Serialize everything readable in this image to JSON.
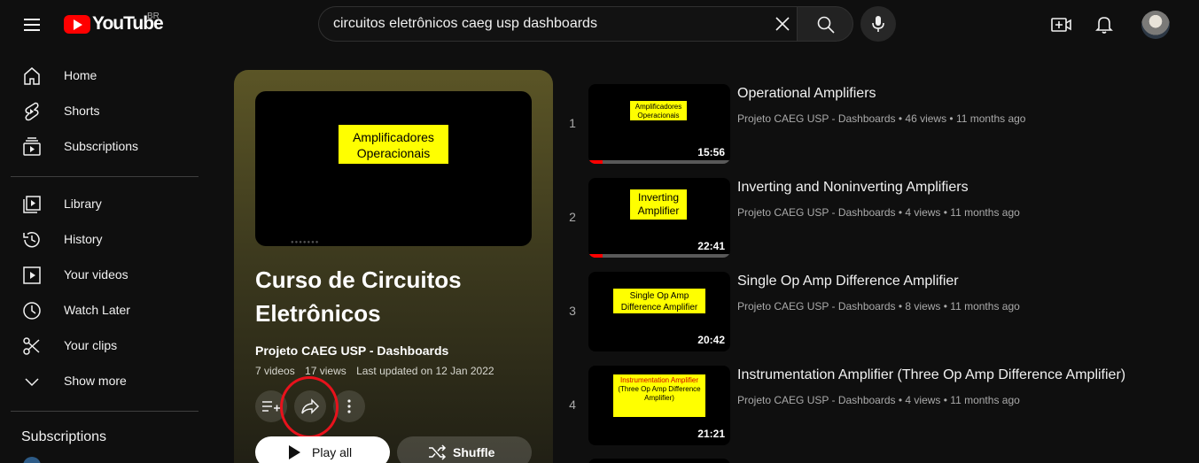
{
  "header": {
    "logo_text": "YouTube",
    "country_code": "BR",
    "search": {
      "value": "circuitos eletrônicos caeg usp dashboards"
    }
  },
  "sidebar": {
    "primary": [
      {
        "label": "Home",
        "icon": "home-icon"
      },
      {
        "label": "Shorts",
        "icon": "shorts-icon"
      },
      {
        "label": "Subscriptions",
        "icon": "subscriptions-icon"
      }
    ],
    "library": [
      {
        "label": "Library",
        "icon": "library-icon"
      },
      {
        "label": "History",
        "icon": "history-icon"
      },
      {
        "label": "Your videos",
        "icon": "your-videos-icon"
      },
      {
        "label": "Watch Later",
        "icon": "watch-later-icon"
      },
      {
        "label": "Your clips",
        "icon": "clips-icon"
      },
      {
        "label": "Show more",
        "icon": "chevron-down-icon"
      }
    ],
    "subscriptions_heading": "Subscriptions"
  },
  "playlist": {
    "thumb_text": "Amplificadores Operacionais",
    "title": "Curso de Circuitos Eletrônicos",
    "owner": "Projeto CAEG USP - Dashboards",
    "video_count": "7 videos",
    "views": "17 views",
    "last_updated": "Last updated on 12 Jan 2022",
    "play_all_label": "Play all",
    "shuffle_label": "Shuffle"
  },
  "videos": [
    {
      "index": "1",
      "thumb_text": "Amplificadores Operacionais",
      "duration": "15:56",
      "title": "Operational Amplifiers",
      "channel": "Projeto CAEG USP - Dashboards",
      "views": "46 views",
      "age": "11 months ago",
      "watched_fraction": 0.1
    },
    {
      "index": "2",
      "thumb_text": "Inverting Amplifier",
      "duration": "22:41",
      "title": "Inverting and Noninverting Amplifiers",
      "channel": "Projeto CAEG USP - Dashboards",
      "views": "4 views",
      "age": "11 months ago",
      "watched_fraction": 0.1
    },
    {
      "index": "3",
      "thumb_text": "Single Op Amp Difference Amplifier",
      "duration": "20:42",
      "title": "Single Op Amp Difference Amplifier",
      "channel": "Projeto CAEG USP - Dashboards",
      "views": "8 views",
      "age": "11 months ago",
      "watched_fraction": 0
    },
    {
      "index": "4",
      "thumb_text_line1": "Instrumentation Amplifier",
      "thumb_text_line2": "(Three Op Amp Difference Amplifier)",
      "duration": "21:21",
      "title": "Instrumentation Amplifier (Three Op Amp Difference Amplifier)",
      "channel": "Projeto CAEG USP - Dashboards",
      "views": "4 views",
      "age": "11 months ago",
      "watched_fraction": 0
    }
  ],
  "colors": {
    "accent_red": "#ff0000",
    "highlight_ring": "#e8121c",
    "thumb_yellow": "#ffff00"
  }
}
